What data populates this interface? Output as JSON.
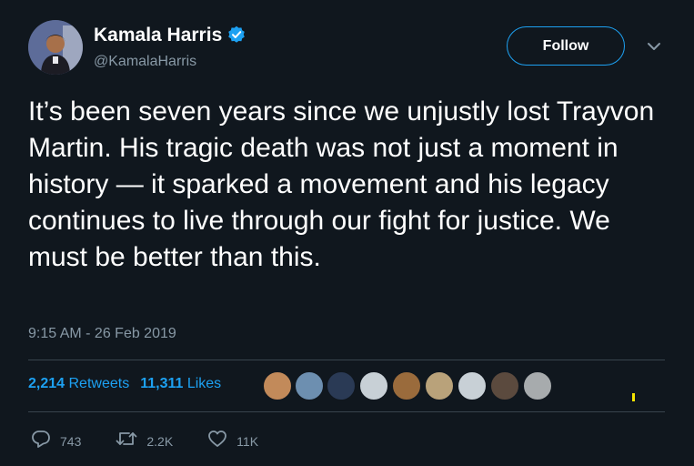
{
  "author": {
    "display_name": "Kamala Harris",
    "handle": "@KamalaHarris",
    "verified_icon": "verified-badge-icon"
  },
  "follow_button": {
    "label": "Follow"
  },
  "tweet": {
    "text": "It’s been seven years since we unjustly lost Trayvon Martin. His tragic death was not just a moment in history — it sparked a movement and his legacy continues to live through our fight for justice. We must be better than this.",
    "timestamp": "9:15 AM - 26 Feb 2019"
  },
  "stats": {
    "retweets_count": "2,214",
    "retweets_label": "Retweets",
    "likes_count": "11,311",
    "likes_label": "Likes"
  },
  "liker_avatars": [
    {
      "name": "liker-avatar-1",
      "color": "#c28a5a"
    },
    {
      "name": "liker-avatar-2",
      "color": "#6d8fb0"
    },
    {
      "name": "liker-avatar-3",
      "color": "#2a3a55"
    },
    {
      "name": "liker-avatar-4",
      "color": "#c8d0d6"
    },
    {
      "name": "liker-avatar-5",
      "color": "#9a6b3c"
    },
    {
      "name": "liker-avatar-6",
      "color": "#b9a27a"
    },
    {
      "name": "liker-avatar-7",
      "color": "#c8d0d6"
    },
    {
      "name": "liker-avatar-8",
      "color": "#5b4a3e"
    },
    {
      "name": "liker-avatar-9",
      "color": "#a7abad"
    }
  ],
  "actions": {
    "reply_count": "743",
    "retweet_count": "2.2K",
    "like_count": "11K"
  },
  "colors": {
    "background": "#10171e",
    "accent": "#1da1f2",
    "secondary_text": "#8899a6",
    "divider": "#38444d"
  }
}
